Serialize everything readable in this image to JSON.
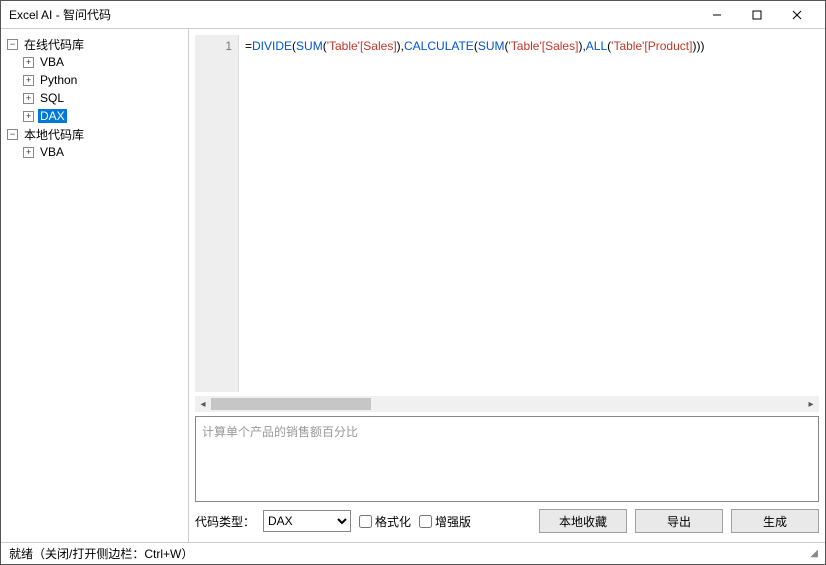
{
  "window": {
    "title": "Excel AI - 智问代码"
  },
  "sidebar": {
    "groups": [
      {
        "label": "在线代码库",
        "expander": "−",
        "indent": 0,
        "selected": false,
        "name": "tree-online-root"
      },
      {
        "label": "VBA",
        "expander": "+",
        "indent": 1,
        "selected": false,
        "name": "tree-online-vba"
      },
      {
        "label": "Python",
        "expander": "+",
        "indent": 1,
        "selected": false,
        "name": "tree-online-python"
      },
      {
        "label": "SQL",
        "expander": "+",
        "indent": 1,
        "selected": false,
        "name": "tree-online-sql"
      },
      {
        "label": "DAX",
        "expander": "+",
        "indent": 1,
        "selected": true,
        "name": "tree-online-dax"
      },
      {
        "label": "本地代码库",
        "expander": "−",
        "indent": 0,
        "selected": false,
        "name": "tree-local-root"
      },
      {
        "label": "VBA",
        "expander": "+",
        "indent": 1,
        "selected": false,
        "name": "tree-local-vba"
      }
    ]
  },
  "editor": {
    "line_no": "1",
    "code_tokens": [
      {
        "t": "=",
        "c": "c-op"
      },
      {
        "t": "DIVIDE",
        "c": "c-func"
      },
      {
        "t": "(",
        "c": "c-op"
      },
      {
        "t": "SUM",
        "c": "c-func"
      },
      {
        "t": "(",
        "c": "c-op"
      },
      {
        "t": "'Table'[Sales]",
        "c": "c-str"
      },
      {
        "t": "),",
        "c": "c-op"
      },
      {
        "t": "CALCULATE",
        "c": "c-func"
      },
      {
        "t": "(",
        "c": "c-op"
      },
      {
        "t": "SUM",
        "c": "c-func"
      },
      {
        "t": "(",
        "c": "c-op"
      },
      {
        "t": "'Table'[Sales]",
        "c": "c-str"
      },
      {
        "t": "),",
        "c": "c-op"
      },
      {
        "t": "ALL",
        "c": "c-func"
      },
      {
        "t": "(",
        "c": "c-op"
      },
      {
        "t": "'Table'[Product]",
        "c": "c-str"
      },
      {
        "t": ")))",
        "c": "c-op"
      }
    ]
  },
  "prompt": {
    "placeholder": "计算单个产品的销售额百分比"
  },
  "controls": {
    "type_label": "代码类型：",
    "type_value": "DAX",
    "format_label": "格式化",
    "enhanced_label": "增强版",
    "favorite_btn": "本地收藏",
    "export_btn": "导出",
    "generate_btn": "生成"
  },
  "status": {
    "text": "就绪（关闭/打开侧边栏：Ctrl+W）"
  }
}
